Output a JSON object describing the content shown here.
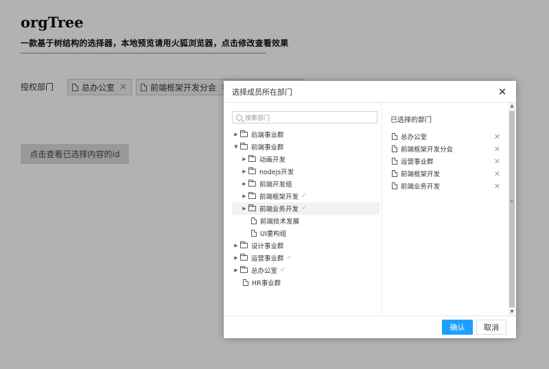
{
  "page": {
    "title": "orgTree",
    "description": "一款基于树结构的选择器，本地预览请用火狐浏览器，点击修改查看效果",
    "auth_label": "授权部门",
    "tags": [
      "总办公室",
      "前端框架开发分会"
    ],
    "view_button": "点击查看已选择内容的id"
  },
  "modal": {
    "title": "选择成员所在部门",
    "close_icon": "close-icon",
    "search_placeholder": "搜索部门",
    "tree": [
      {
        "label": "后端事业群",
        "type": "folder",
        "arrow": "▶",
        "level": 0,
        "checked": false
      },
      {
        "label": "前端事业群",
        "type": "folder",
        "arrow": "▼",
        "level": 0,
        "checked": false
      },
      {
        "label": "动画开发",
        "type": "folder",
        "arrow": "▶",
        "level": 1,
        "checked": false
      },
      {
        "label": "nodejs开发",
        "type": "folder",
        "arrow": "▶",
        "level": 1,
        "checked": false
      },
      {
        "label": "前端开发组",
        "type": "folder",
        "arrow": "▶",
        "level": 1,
        "checked": false
      },
      {
        "label": "前端框架开发",
        "type": "folder",
        "arrow": "▶",
        "level": 1,
        "checked": true
      },
      {
        "label": "前端业务开发",
        "type": "folder",
        "arrow": "▶",
        "level": 1,
        "checked": true,
        "hover": true
      },
      {
        "label": "前端技术发展",
        "type": "doc",
        "arrow": "",
        "level": 2,
        "checked": false
      },
      {
        "label": "UI重构组",
        "type": "doc",
        "arrow": "",
        "level": 2,
        "checked": false
      },
      {
        "label": "设计事业群",
        "type": "folder",
        "arrow": "▶",
        "level": 0,
        "checked": false
      },
      {
        "label": "运营事业群",
        "type": "folder",
        "arrow": "▶",
        "level": 0,
        "checked": true
      },
      {
        "label": "总办公室",
        "type": "folder",
        "arrow": "▶",
        "level": 0,
        "checked": true
      },
      {
        "label": "HR事业群",
        "type": "doc",
        "arrow": "",
        "level": 1,
        "checked": false
      }
    ],
    "selected_title": "已选择的部门",
    "selected": [
      "总办公室",
      "前端框架开发分会",
      "运营事业群",
      "前端框架开发",
      "前端业务开发"
    ],
    "confirm_label": "确认",
    "cancel_label": "取消",
    "accent_color": "#1e9fff"
  }
}
